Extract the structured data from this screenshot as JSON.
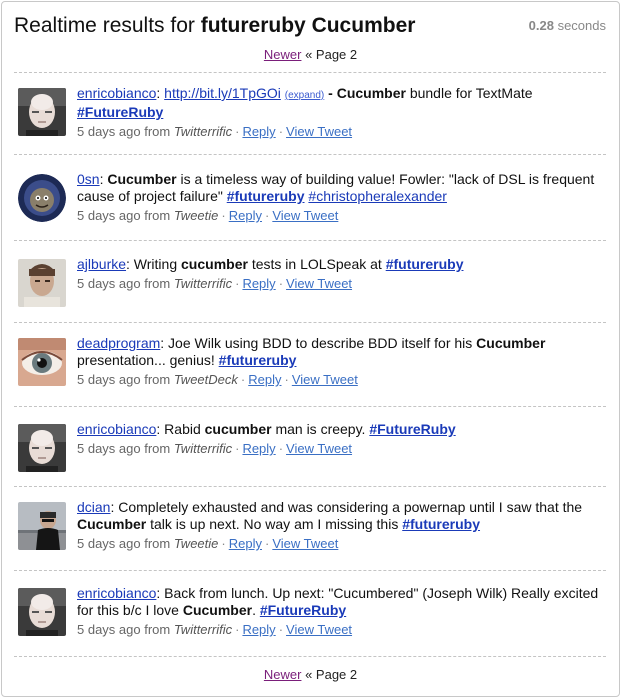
{
  "header": {
    "title_prefix": "Realtime results for ",
    "title_query": "futureruby Cucumber",
    "timing_value": "0.28",
    "timing_unit": " seconds"
  },
  "pager": {
    "newer_label": "Newer",
    "separator": " « ",
    "page_label": "Page 2"
  },
  "tweets": [
    {
      "user": "enricobianco",
      "parts": [
        ": ",
        "http://bit.ly/1TpGOi",
        " ",
        "(expand)",
        " - ",
        "Cucumber",
        " bundle for TextMate ",
        "#FutureRuby"
      ],
      "time": "5 days ago from ",
      "source": "Twitterrific",
      "reply": "Reply",
      "view": "View Tweet"
    },
    {
      "user": "0sn",
      "parts": [
        ": ",
        "Cucumber",
        " is a timeless way of building value! Fowler: \"lack of DSL is frequent cause of project failure\" ",
        "#futureruby",
        " ",
        "#christopheralexander"
      ],
      "time": "5 days ago from ",
      "source": "Tweetie",
      "reply": "Reply",
      "view": "View Tweet"
    },
    {
      "user": "ajlburke",
      "parts": [
        ": Writing ",
        "cucumber",
        " tests in LOLSpeak at ",
        "#futureruby"
      ],
      "time": "5 days ago from ",
      "source": "Twitterrific",
      "reply": "Reply",
      "view": "View Tweet"
    },
    {
      "user": "deadprogram",
      "parts": [
        ": Joe Wilk using BDD to describe BDD itself for his ",
        "Cucumber",
        " presentation... genius! ",
        "#futureruby"
      ],
      "time": "5 days ago from ",
      "source": "TweetDeck",
      "reply": "Reply",
      "view": "View Tweet"
    },
    {
      "user": "enricobianco",
      "parts": [
        ": Rabid ",
        "cucumber",
        " man is creepy. ",
        "#FutureRuby"
      ],
      "time": "5 days ago from ",
      "source": "Twitterrific",
      "reply": "Reply",
      "view": "View Tweet"
    },
    {
      "user": "dcian",
      "parts": [
        ": Completely exhausted and was considering a powernap until I saw that the ",
        "Cucumber",
        " talk is up next. No way am I missing this ",
        "#futureruby"
      ],
      "time": "5 days ago from ",
      "source": "Tweetie",
      "reply": "Reply",
      "view": "View Tweet"
    },
    {
      "user": "enricobianco",
      "parts": [
        ": Back from lunch. Up next: \"Cucumbered\" (Joseph Wilk) Really excited for this b/c I love ",
        "Cucumber",
        ". ",
        "#FutureRuby"
      ],
      "time": "5 days ago from ",
      "source": "Twitterrific",
      "reply": "Reply",
      "view": "View Tweet"
    }
  ],
  "icons": {
    "avatars": [
      "bald-man-avatar",
      "cartoon-lion-avatar",
      "man-portrait-avatar",
      "eye-closeup-avatar",
      "bald-man-avatar",
      "man-outdoors-avatar",
      "bald-man-avatar"
    ]
  },
  "colors": {
    "link": "#1a3ab8",
    "visited_link": "#7a1e7a",
    "meta_link": "#3a6fc4"
  }
}
